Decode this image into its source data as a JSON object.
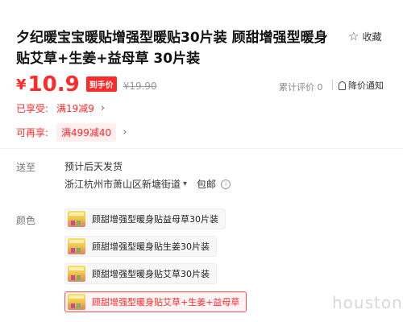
{
  "product": {
    "title": "夕纪暖宝宝暖贴增强型暖贴30片装 顾甜增强型暖身贴艾草+生姜+益母草 30片装",
    "favorite_label": "收藏"
  },
  "price": {
    "symbol": "¥",
    "current": "10.9",
    "badge": "到手价",
    "original": "¥19.90",
    "review_count": "累计评价 0",
    "notify_label": "降价通知"
  },
  "promotions": [
    {
      "label": "已享受:",
      "value": "满19减9"
    },
    {
      "label": "可再享:",
      "value": "满499减40"
    }
  ],
  "shipping": {
    "label": "送至",
    "delivery_note": "预计后天发货",
    "address": "浙江杭州市萧山区新塘街道",
    "free_shipping": "包邮"
  },
  "color": {
    "label": "颜色",
    "options": [
      {
        "label": "顾甜增强型暖身贴益母草30片装",
        "selected": false
      },
      {
        "label": "顾甜增强型暖身贴生姜30片装",
        "selected": false
      },
      {
        "label": "顾甜增强型暖身贴艾草30片装",
        "selected": false
      },
      {
        "label": "顾甜增强型暖身贴艾草+生姜+益母草",
        "selected": true
      }
    ]
  },
  "watermark": "houston",
  "colors": {
    "accent": "#ff2a2a",
    "muted": "#999999"
  },
  "icons": [
    "star-icon",
    "bell-icon",
    "chevron-right-icon",
    "caret-down-icon",
    "info-icon"
  ]
}
